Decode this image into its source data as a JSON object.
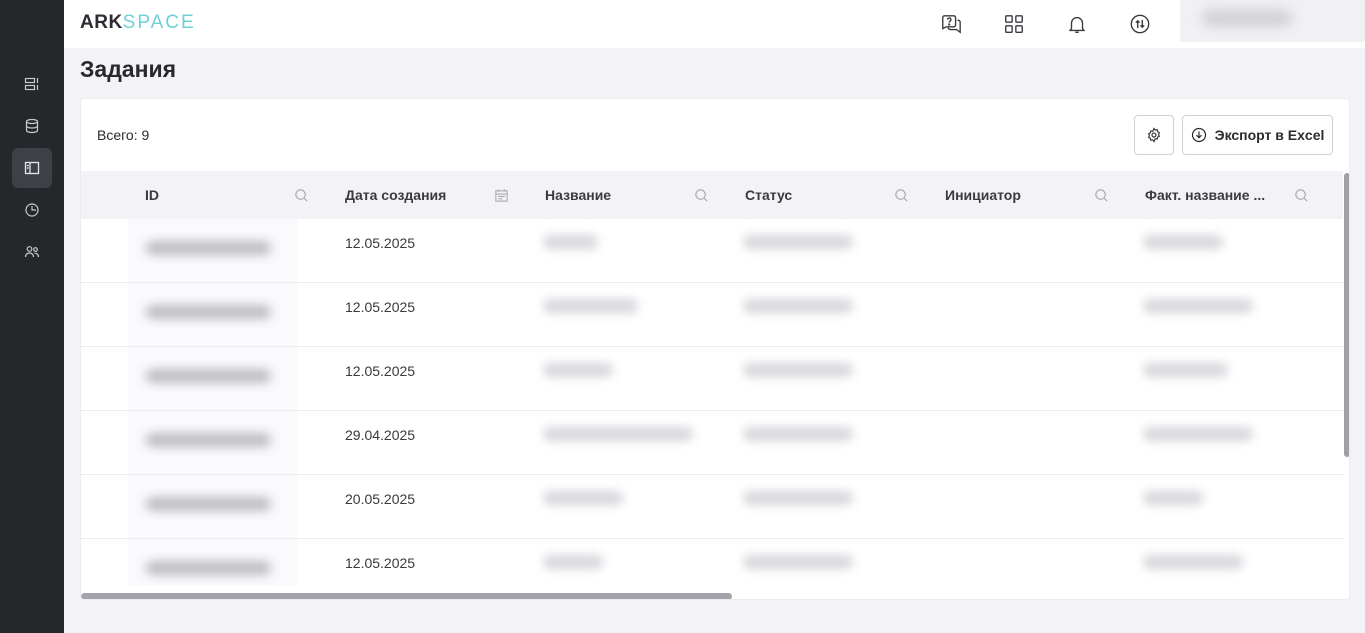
{
  "app": {
    "logo_part1": "ARK",
    "logo_part2": "SPACE"
  },
  "sidebar": {
    "items": [
      {
        "icon": "list-panel-icon",
        "active": false
      },
      {
        "icon": "database-icon",
        "active": false
      },
      {
        "icon": "layout-sidebar-icon",
        "active": true
      },
      {
        "icon": "clock-chart-icon",
        "active": false
      },
      {
        "icon": "users-icon",
        "active": false
      }
    ]
  },
  "header": {
    "icons": [
      "help-chat-icon",
      "apps-grid-icon",
      "bell-icon",
      "sync-arrows-icon"
    ]
  },
  "page": {
    "title": "Задания"
  },
  "toolbar": {
    "total_label": "Всего: 9",
    "export_label": "Экспорт в Excel"
  },
  "table": {
    "columns": [
      {
        "label": "ID",
        "icon": "search-icon"
      },
      {
        "label": "Дата создания",
        "icon": "calendar-icon"
      },
      {
        "label": "Название",
        "icon": "search-icon"
      },
      {
        "label": "Статус",
        "icon": "search-icon"
      },
      {
        "label": "Инициатор",
        "icon": "search-icon"
      },
      {
        "label": "Факт. название ...",
        "icon": "search-icon"
      }
    ],
    "rows": [
      {
        "date": "12.05.2025"
      },
      {
        "date": "12.05.2025"
      },
      {
        "date": "12.05.2025"
      },
      {
        "date": "29.04.2025"
      },
      {
        "date": "20.05.2025"
      },
      {
        "date": "12.05.2025"
      }
    ]
  },
  "colors": {
    "sidebar_bg": "#25272b",
    "logo_accent": "#6fd0d6",
    "page_bg": "#f3f3f7"
  }
}
